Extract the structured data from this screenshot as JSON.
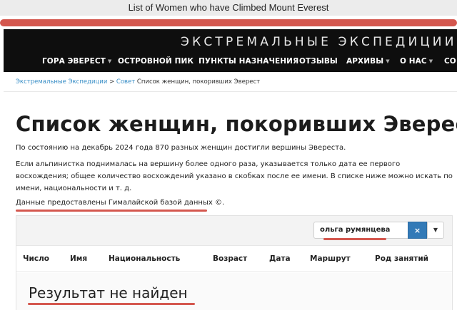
{
  "browser": {
    "page_title": "List of Women who have Climbed Mount Everest"
  },
  "colors": {
    "highlight": "#d4574e",
    "header_bg": "#0e0e0e",
    "link": "#3a8fc7",
    "primary_button": "#337ab7"
  },
  "header": {
    "site_title": "ЭКСТРЕМАЛЬНЫЕ ЭКСПЕДИЦИИ",
    "nav": [
      {
        "label": "ГОРА ЭВЕРЕСТ",
        "has_dropdown": true
      },
      {
        "label": "ОСТРОВНОЙ ПИК",
        "has_dropdown": false
      },
      {
        "label": "ПУНКТЫ НАЗНАЧЕНИЯ",
        "has_dropdown": false
      },
      {
        "label": "ОТЗЫВЫ",
        "has_dropdown": false
      },
      {
        "label": "АРХИВЫ",
        "has_dropdown": true
      },
      {
        "label": "О НАС",
        "has_dropdown": true
      },
      {
        "label": "СО",
        "has_dropdown": false
      }
    ],
    "dropdown_icon": "chevron-down-icon"
  },
  "breadcrumb": {
    "items": [
      "Экстремальные Экспедиции",
      "Совет"
    ],
    "separator": ">",
    "current": "Список женщин, покоривших Эверест"
  },
  "main": {
    "title": "Список женщин, покоривших Эверест",
    "para1": "По состоянию на декабрь 2024 года 870 разных женщин достигли вершины Эвереста.",
    "para2": "Если альпинистка поднималась на вершину более одного раза, указывается только дата ее первого восхождения; общее количество восхождений указано в скобках после ее имени. В списке ниже можно искать по имени, национальности и т. д.",
    "para3": "Данные предоставлены Гималайской базой данных ©."
  },
  "table": {
    "search_value": "ольга румянцева",
    "clear_label": "×",
    "dropdown_label": "▼",
    "columns": [
      "Число",
      "Имя",
      "Национальность",
      "Возраст",
      "Дата",
      "Маршрут",
      "Род занятий"
    ],
    "empty_message": "Результат не найден"
  }
}
